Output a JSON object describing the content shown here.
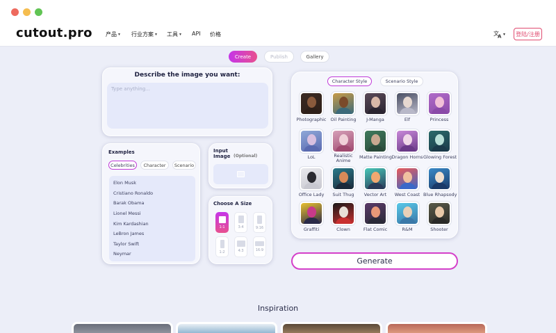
{
  "window": {
    "traffic_lights": [
      "close",
      "minimize",
      "maximize"
    ]
  },
  "nav": {
    "logo": "cutout.pro",
    "items": [
      {
        "label": "产品",
        "has_dropdown": true
      },
      {
        "label": "行业方案",
        "has_dropdown": true
      },
      {
        "label": "工具",
        "has_dropdown": true
      },
      {
        "label": "API",
        "has_dropdown": false
      },
      {
        "label": "价格",
        "has_dropdown": false
      }
    ],
    "lang_icon": "translate-icon",
    "login_label": "登陆/注册"
  },
  "modes": {
    "create": "Create",
    "publish": "Publish",
    "gallery": "Gallery",
    "active": "create"
  },
  "describe": {
    "title": "Describe the image you want:",
    "placeholder": "Type anything..."
  },
  "examples": {
    "title": "Examples",
    "tabs": [
      "Celebrities",
      "Character",
      "Scenario"
    ],
    "active_tab": "Celebrities",
    "items": [
      "Elon Musk",
      "Cristiano Ronaldo",
      "Barak Obama",
      "Lionel Messi",
      "Kim Kardashian",
      "LeBron James",
      "Taylor Swift",
      "Neymar"
    ]
  },
  "input_image": {
    "title": "Input Image",
    "optional": "(Optional)",
    "upload_icon": "image-upload-icon"
  },
  "size": {
    "title": "Choose A Size",
    "options": [
      "1:1",
      "3:4",
      "9:16",
      "1:2",
      "4:3",
      "16:9"
    ],
    "selected": "1:1"
  },
  "styles": {
    "tabs": [
      "Character Style",
      "Scenario Style"
    ],
    "active_tab": "Character Style",
    "items": [
      {
        "label": "Photographic",
        "colors": [
          "#3b2a22",
          "#8a5a3c",
          "#2e1f18"
        ]
      },
      {
        "label": "Oil Painting",
        "colors": [
          "#c89b48",
          "#7a4a2a",
          "#3c6a7a"
        ]
      },
      {
        "label": "J-Manga",
        "colors": [
          "#5a4a58",
          "#d9b8a8",
          "#2a2430"
        ]
      },
      {
        "label": "Elf",
        "colors": [
          "#4a4f63",
          "#e6d8d0",
          "#b8b8c8"
        ]
      },
      {
        "label": "Princess",
        "colors": [
          "#b06cc8",
          "#f2c0d8",
          "#8a4aa8"
        ]
      },
      {
        "label": "LoL",
        "colors": [
          "#8fa8d8",
          "#d8c0e0",
          "#5a6ab0"
        ]
      },
      {
        "label": "Realistic Anime",
        "colors": [
          "#d6a0b8",
          "#f0d0d8",
          "#a04a70"
        ]
      },
      {
        "label": "Matte Painting",
        "colors": [
          "#3f7a5c",
          "#c8a890",
          "#2a4a3a"
        ]
      },
      {
        "label": "Dragon Horns",
        "colors": [
          "#c888d8",
          "#f0d8e8",
          "#6a3a88"
        ]
      },
      {
        "label": "Glowing Forest",
        "colors": [
          "#2a6a6a",
          "#b8e0d8",
          "#1a3a4a"
        ]
      },
      {
        "label": "Office Lady",
        "colors": [
          "#e8e8ec",
          "#2a2a30",
          "#c8c8d0"
        ]
      },
      {
        "label": "Suit Thug",
        "colors": [
          "#2a7a8a",
          "#d88a58",
          "#1a2a3a"
        ]
      },
      {
        "label": "Vector Art",
        "colors": [
          "#48c8b8",
          "#f0a870",
          "#2a3a58"
        ]
      },
      {
        "label": "West Coast",
        "colors": [
          "#e85a5a",
          "#f0c0a0",
          "#3a68c8"
        ]
      },
      {
        "label": "Blue Rhapsody",
        "colors": [
          "#3a8ac8",
          "#f0e0d0",
          "#1a3a68"
        ]
      },
      {
        "label": "Graffiti",
        "colors": [
          "#e8c030",
          "#c83a8a",
          "#2a2a48"
        ]
      },
      {
        "label": "Clown",
        "colors": [
          "#181818",
          "#e8e0d8",
          "#c83030"
        ]
      },
      {
        "label": "Flat Comic",
        "colors": [
          "#5a3a68",
          "#e89878",
          "#2a2a38"
        ]
      },
      {
        "label": "R&M",
        "colors": [
          "#58c8e8",
          "#e8d0b8",
          "#3a78a8"
        ]
      },
      {
        "label": "Shooter",
        "colors": [
          "#5a5a48",
          "#e8c8a8",
          "#2a2a28"
        ]
      }
    ]
  },
  "generate_label": "Generate",
  "inspiration": {
    "title": "Inspiration",
    "cards": [
      {
        "colors": [
          "#6a6e7a",
          "#9a9ea8"
        ]
      },
      {
        "colors": [
          "#e8eef4",
          "#7aa8c8"
        ]
      },
      {
        "colors": [
          "#5a4838",
          "#a88a68"
        ]
      },
      {
        "colors": [
          "#b8685a",
          "#e8a888"
        ]
      }
    ]
  }
}
